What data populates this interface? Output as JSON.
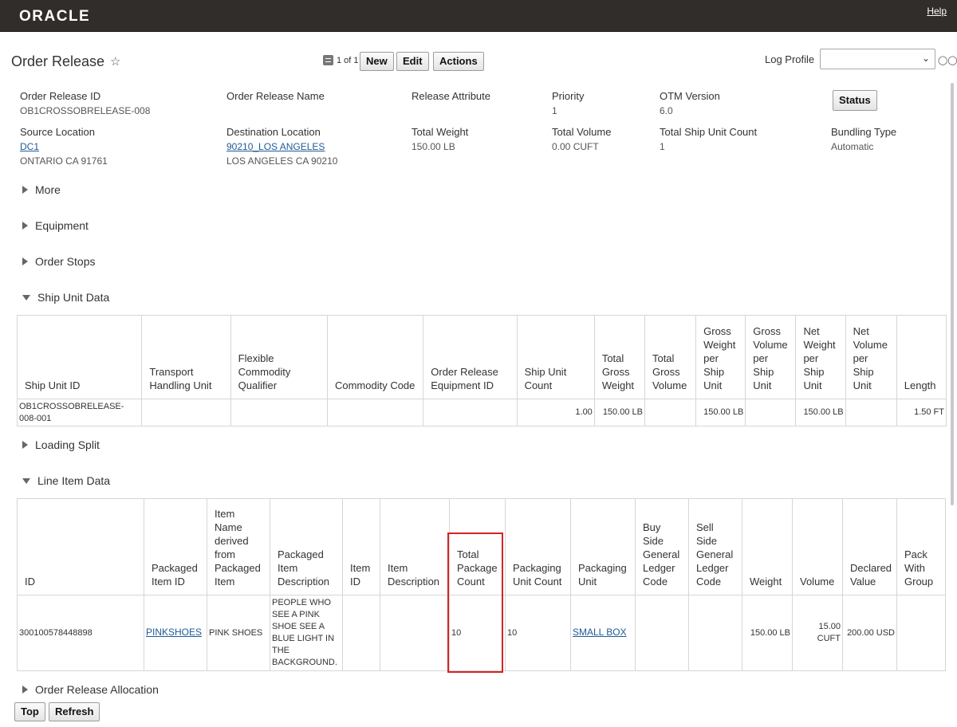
{
  "app": {
    "logo": "ORACLE",
    "help": "Help"
  },
  "page": {
    "title": "Order Release",
    "star": "☆"
  },
  "toolbar": {
    "pager": "1 of 1",
    "new": "New",
    "edit": "Edit",
    "actions": "Actions",
    "log_profile_label": "Log Profile",
    "log_profile_value": "",
    "status": "Status"
  },
  "header": {
    "order_release_id": {
      "label": "Order Release ID",
      "value": "OB1CROSSOBRELEASE-008"
    },
    "order_release_name": {
      "label": "Order Release Name",
      "value": ""
    },
    "release_attribute": {
      "label": "Release Attribute",
      "value": ""
    },
    "priority": {
      "label": "Priority",
      "value": "1"
    },
    "otm_version": {
      "label": "OTM Version",
      "value": "6.0"
    },
    "source_location": {
      "label": "Source Location",
      "link": "DC1",
      "address": "ONTARIO CA 91761"
    },
    "destination_location": {
      "label": "Destination Location",
      "link": "90210_LOS ANGELES",
      "address": "LOS ANGELES CA 90210"
    },
    "total_weight": {
      "label": "Total Weight",
      "value": "150.00 LB"
    },
    "total_volume": {
      "label": "Total Volume",
      "value": "0.00 CUFT"
    },
    "total_ship_unit_count": {
      "label": "Total Ship Unit Count",
      "value": "1"
    },
    "bundling_type": {
      "label": "Bundling Type",
      "value": "Automatic"
    }
  },
  "sections": {
    "more": "More",
    "equipment": "Equipment",
    "order_stops": "Order Stops",
    "ship_unit_data": "Ship Unit Data",
    "loading_split": "Loading Split",
    "line_item_data": "Line Item Data",
    "order_release_allocation": "Order Release Allocation"
  },
  "ship_unit_table": {
    "headers": [
      "Ship Unit ID",
      "Transport Handling Unit",
      "Flexible Commodity Qualifier",
      "Commodity Code",
      "Order Release Equipment ID",
      "Ship Unit Count",
      "Total Gross Weight",
      "Total Gross Volume",
      "Gross Weight per Ship Unit",
      "Gross Volume per Ship Unit",
      "Net Weight per Ship Unit",
      "Net Volume per Ship Unit",
      "Length"
    ],
    "rows": [
      [
        "OB1CROSSOBRELEASE-008-001",
        "",
        "",
        "",
        "",
        "1.00",
        "150.00 LB",
        "",
        "150.00 LB",
        "",
        "150.00 LB",
        "",
        "1.50 FT"
      ]
    ]
  },
  "line_item_table": {
    "headers": [
      "ID",
      "Packaged Item ID",
      "Item Name derived from Packaged Item",
      "Packaged Item Description",
      "Item ID",
      "Item Description",
      "Total Package Count",
      "Packaging Unit Count",
      "Packaging Unit",
      "Buy Side General Ledger Code",
      "Sell Side General Ledger Code",
      "Weight",
      "Volume",
      "Declared Value",
      "Pack With Group"
    ],
    "rows": [
      [
        "300100578448898",
        "PINKSHOES",
        "PINK SHOES",
        "PEOPLE WHO SEE A PINK SHOE SEE A BLUE LIGHT IN THE BACKGROUND.",
        "",
        "",
        "10",
        "10",
        "SMALL BOX",
        "",
        "",
        "150.00 LB",
        "15.00 CUFT",
        "200.00 USD",
        ""
      ]
    ]
  },
  "footer": {
    "top": "Top",
    "refresh": "Refresh"
  },
  "icons": {
    "star": "star-icon",
    "pager": "list-icon",
    "dropdown": "chevron-down-icon",
    "glasses": "glasses-icon",
    "expand": "triangle-right-icon",
    "collapse": "triangle-down-icon"
  },
  "colors": {
    "header_bg": "#312d2a",
    "link": "#1f5a96",
    "highlight": "#d62323"
  }
}
